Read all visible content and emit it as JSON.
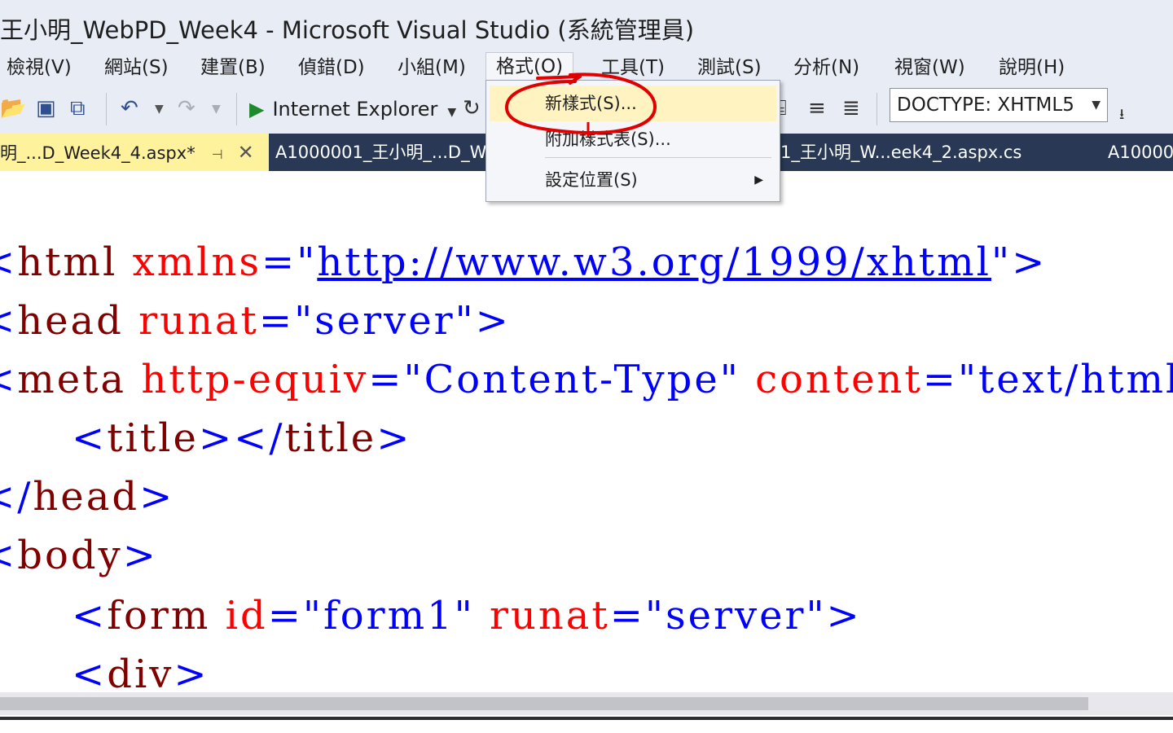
{
  "window": {
    "title": "王小明_WebPD_Week4 - Microsoft Visual Studio (系統管理員)"
  },
  "menu": {
    "items": [
      "檢視(V)",
      "網站(S)",
      "建置(B)",
      "偵錯(D)",
      "小組(M)",
      "格式(O)",
      "工具(T)",
      "測試(S)",
      "分析(N)",
      "視窗(W)",
      "說明(H)"
    ]
  },
  "toolbar": {
    "run_target": "Internet Explorer",
    "doctype": "DOCTYPE: XHTML5"
  },
  "tabs": [
    {
      "label": "明_...D_Week4_4.aspx*"
    },
    {
      "label": "A1000001_王小明_...D_W"
    },
    {
      "label": "1_王小明_W...eek4_2.aspx.cs"
    },
    {
      "label": "A10000"
    }
  ],
  "format_menu": {
    "items": [
      "新樣式(S)...",
      "附加樣式表(S)...",
      "設定位置(S)"
    ]
  },
  "code": {
    "lines": [
      {
        "t1": "<",
        "tag": "html",
        "attr": "xmlns",
        "eq": "=\"",
        "link": "http://www.w3.org/1999/xhtml",
        "end": "\">"
      },
      {
        "t1": "<",
        "tag": "head",
        "attr": "runat",
        "eq": "=\"",
        "val": "server",
        "end": "\">"
      },
      {
        "t1": "<",
        "tag": "meta",
        "attr": "http-equiv",
        "eq": "=\"",
        "val": "Content-Type",
        "q": "\"",
        "attr2": "content",
        "eq2": "=\"",
        "val2": "text/html; c"
      },
      {
        "open": "<",
        "tag": "title",
        "mid": "></",
        "tag2": "title",
        "close": ">"
      },
      {
        "open": "</",
        "tag": "head",
        "close": ">"
      },
      {
        "open": "<",
        "tag": "body",
        "close": ">"
      },
      {
        "open": "<",
        "tag": "form",
        "attr": "id",
        "eq": "=\"",
        "val": "form1",
        "q": "\"",
        "attr2": "runat",
        "eq2": "=\"",
        "val2": "server",
        "end": "\">"
      },
      {
        "open": "<",
        "tag": "div",
        "close": ">"
      }
    ]
  },
  "colors": {
    "tag": "#800000",
    "attr": "#ff0000",
    "value": "#0000ff",
    "tab_active": "#fff29d",
    "tabbar": "#293955",
    "annotation": "#e00000"
  }
}
